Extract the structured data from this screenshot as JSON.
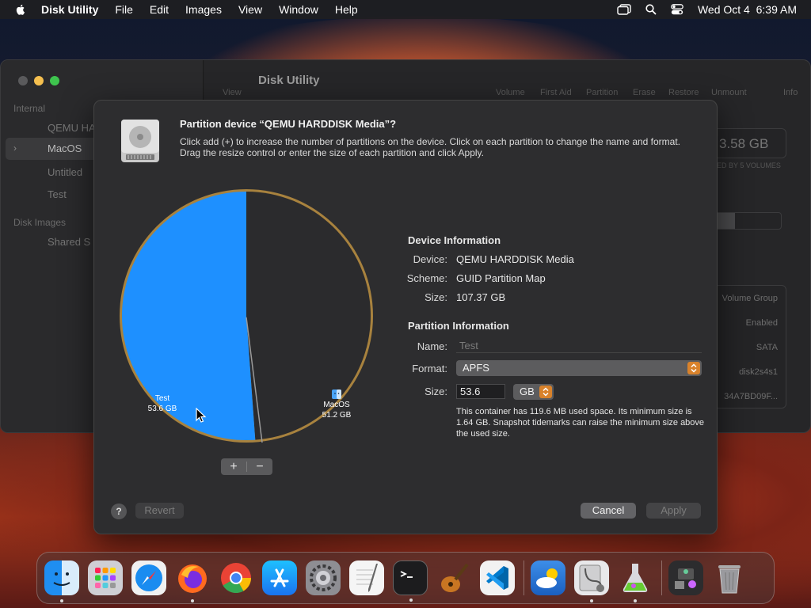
{
  "menubar": {
    "app_name": "Disk Utility",
    "menus": [
      "File",
      "Edit",
      "Images",
      "View",
      "Window",
      "Help"
    ],
    "datetime": "Wed Oct 4  6:39 AM",
    "icons": [
      "apple-icon",
      "window-stack-icon",
      "spotlight-search-icon",
      "control-center-icon"
    ]
  },
  "background_window": {
    "title": "Disk Utility",
    "sidebar": {
      "section_internal": "Internal",
      "items": [
        "QEMU HA",
        "MacOS",
        "Untitled",
        "Test"
      ],
      "section_disk_images": "Disk Images",
      "disk_images": [
        "Shared S"
      ]
    },
    "toolbar": [
      "View",
      "Volume",
      "First Aid",
      "Partition",
      "Erase",
      "Restore",
      "Unmount",
      "Info"
    ],
    "capacity": "3.58 GB",
    "capacity_sub": "ED BY 5 VOLUMES",
    "info_rows": [
      "Volume Group",
      "Enabled",
      "SATA",
      "disk2s4s1",
      "34A7BD09F..."
    ]
  },
  "dialog": {
    "title": "Partition device “QEMU HARDDISK Media”?",
    "description": "Click add (+) to increase the number of partitions on the device. Click on each partition to change the name and format. Drag the resize control or enter the size of each partition and click Apply.",
    "pie": {
      "slices": [
        {
          "name": "MacOS",
          "size": "51.2 GB",
          "value": 51.2,
          "color": "#2b2b2d"
        },
        {
          "name": "Test",
          "size": "53.6 GB",
          "value": 53.6,
          "color": "#1e90ff"
        }
      ],
      "add_label": "+",
      "remove_label": "−"
    },
    "device_info": {
      "heading": "Device Information",
      "device_label": "Device:",
      "device_value": "QEMU HARDDISK Media",
      "scheme_label": "Scheme:",
      "scheme_value": "GUID Partition Map",
      "size_label": "Size:",
      "size_value": "107.37 GB"
    },
    "partition_info": {
      "heading": "Partition Information",
      "name_label": "Name:",
      "name_placeholder": "Test",
      "format_label": "Format:",
      "format_value": "APFS",
      "size_label": "Size:",
      "size_value": "53.6",
      "size_unit": "GB",
      "note": "This container has 119.6 MB used space. Its minimum size is 1.64 GB. Snapshot tidemarks can raise the minimum size above the used size."
    },
    "buttons": {
      "help": "?",
      "revert": "Revert",
      "cancel": "Cancel",
      "apply": "Apply"
    }
  },
  "dock": {
    "apps": [
      "Finder",
      "Launchpad",
      "Safari",
      "Firefox",
      "Chrome",
      "App Store",
      "System Settings",
      "TextEdit",
      "Terminal",
      "GarageBand",
      "Visual Studio Code",
      "Weather",
      "Disk Utility",
      "Xcode Instruments",
      "Downloads",
      "Trash"
    ]
  }
}
